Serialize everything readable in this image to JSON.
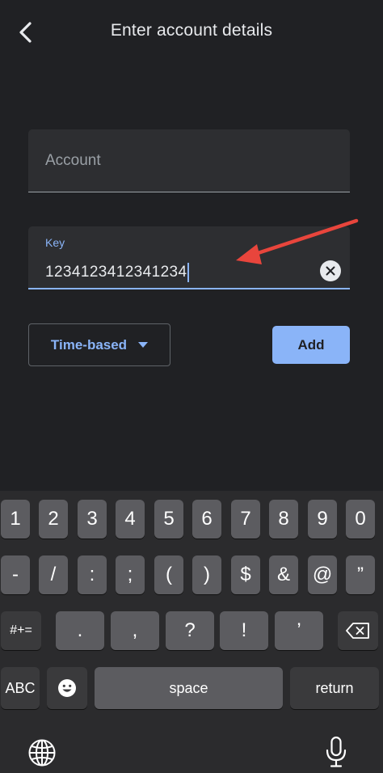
{
  "header": {
    "title": "Enter account details"
  },
  "account_field": {
    "placeholder": "Account",
    "value": ""
  },
  "key_field": {
    "label": "Key",
    "value": "1234123412341234"
  },
  "type_select": {
    "selected": "Time-based"
  },
  "add_button": {
    "label": "Add"
  },
  "keyboard": {
    "row1": [
      "1",
      "2",
      "3",
      "4",
      "5",
      "6",
      "7",
      "8",
      "9",
      "0"
    ],
    "row2": [
      "-",
      "/",
      ":",
      ";",
      "(",
      ")",
      "$",
      "&",
      "@",
      "”"
    ],
    "row3_symbols_key": "#+=",
    "row3": [
      ".",
      ",",
      "?",
      "!",
      "’"
    ],
    "abc_key": "ABC",
    "space_key": "space",
    "return_key": "return"
  },
  "colors": {
    "background": "#202124",
    "accent": "#8ab4f8",
    "annotation_arrow": "#e8453c"
  }
}
